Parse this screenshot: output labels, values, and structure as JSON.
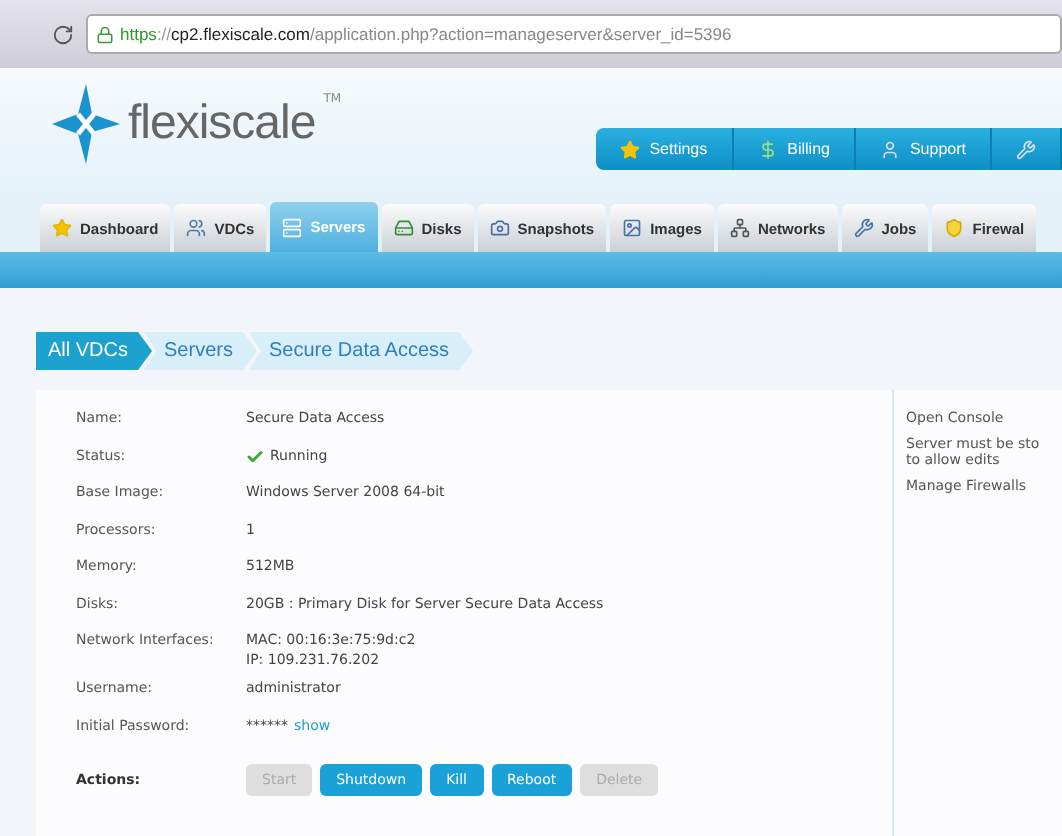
{
  "browser": {
    "url_scheme": "https",
    "url_separator": "://",
    "url_host": "cp2.flexiscale.com",
    "url_path": "/application.php?action=manageserver&server_id=5396"
  },
  "logo": {
    "name": "flexiscale",
    "mark": "TM"
  },
  "top_nav": [
    {
      "label": "Settings"
    },
    {
      "label": "Billing"
    },
    {
      "label": "Support"
    },
    {
      "kind": "icon"
    }
  ],
  "tabs": [
    {
      "label": "Dashboard",
      "selected": false
    },
    {
      "label": "VDCs",
      "selected": false
    },
    {
      "label": "Servers",
      "selected": true
    },
    {
      "label": "Disks",
      "selected": false
    },
    {
      "label": "Snapshots",
      "selected": false
    },
    {
      "label": "Images",
      "selected": false
    },
    {
      "label": "Networks",
      "selected": false
    },
    {
      "label": "Jobs",
      "selected": false
    },
    {
      "label": "Firewal",
      "selected": false
    }
  ],
  "breadcrumb": [
    {
      "label": "All VDCs",
      "selected": true
    },
    {
      "label": "Servers",
      "selected": false
    },
    {
      "label": "Secure Data Access",
      "selected": false
    }
  ],
  "details": [
    {
      "label": "Name:",
      "kind": "text",
      "value": "Secure Data Access"
    },
    {
      "label": "Status:",
      "kind": "status",
      "value": "Running"
    },
    {
      "label": "Base Image:",
      "kind": "text",
      "value": "Windows Server 2008 64-bit"
    },
    {
      "label": "Processors:",
      "kind": "text",
      "value": "1"
    },
    {
      "label": "Memory:",
      "kind": "text",
      "value": "512MB"
    },
    {
      "label": "Disks:",
      "kind": "text",
      "value": "20GB : Primary Disk for Server Secure Data Access"
    },
    {
      "label": "Network Interfaces:",
      "kind": "lines",
      "lines": [
        "MAC: 00:16:3e:75:9d:c2",
        "IP: 109.231.76.202"
      ]
    },
    {
      "label": "Username:",
      "kind": "text",
      "value": "administrator"
    },
    {
      "label": "Initial Password:",
      "kind": "password",
      "value": "******",
      "link": "show"
    }
  ],
  "actions": {
    "label": "Actions:",
    "buttons": [
      {
        "label": "Start",
        "disabled": true
      },
      {
        "label": "Shutdown",
        "disabled": false
      },
      {
        "label": "Kill",
        "disabled": false
      },
      {
        "label": "Reboot",
        "disabled": false
      },
      {
        "label": "Delete",
        "disabled": true
      }
    ]
  },
  "side_links": [
    {
      "label": "Open Console",
      "kind": "link"
    },
    {
      "label": "Server must be sto",
      "kind": "note",
      "extra": "to allow edits"
    },
    {
      "label": "Manage Firewalls",
      "kind": "link"
    }
  ]
}
